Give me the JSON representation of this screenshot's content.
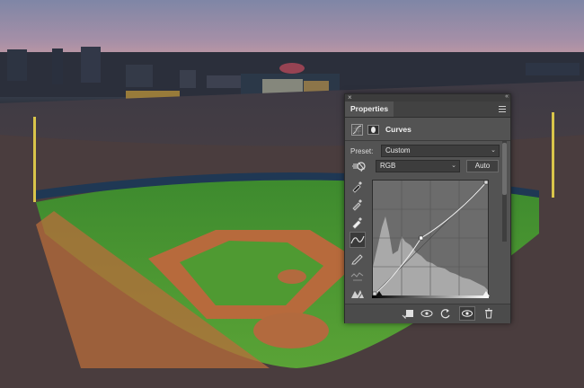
{
  "panel": {
    "title": "Properties",
    "adjustment_type": "Curves",
    "preset_label": "Preset:",
    "preset_value": "Custom",
    "channel_value": "RGB",
    "auto_label": "Auto",
    "close_glyph": "×",
    "collapse_glyph": "«"
  },
  "icons": {
    "tools": [
      "target-adjust-icon",
      "black-point-eyedropper-icon",
      "gray-point-eyedropper-icon",
      "white-point-eyedropper-icon",
      "curve-points-icon",
      "pencil-draw-icon",
      "smooth-curve-icon",
      "clipping-warning-icon"
    ],
    "footer": [
      "clip-to-layer-icon",
      "view-previous-state-icon",
      "reset-icon",
      "visibility-icon",
      "delete-icon"
    ]
  },
  "colors": {
    "panel_bg": "#535353",
    "graph_bg": "#6c6c6c",
    "histogram": "#a9a9a9"
  },
  "curve": {
    "points": [
      [
        0,
        0
      ],
      [
        0.42,
        0.5
      ],
      [
        1,
        1
      ]
    ]
  }
}
